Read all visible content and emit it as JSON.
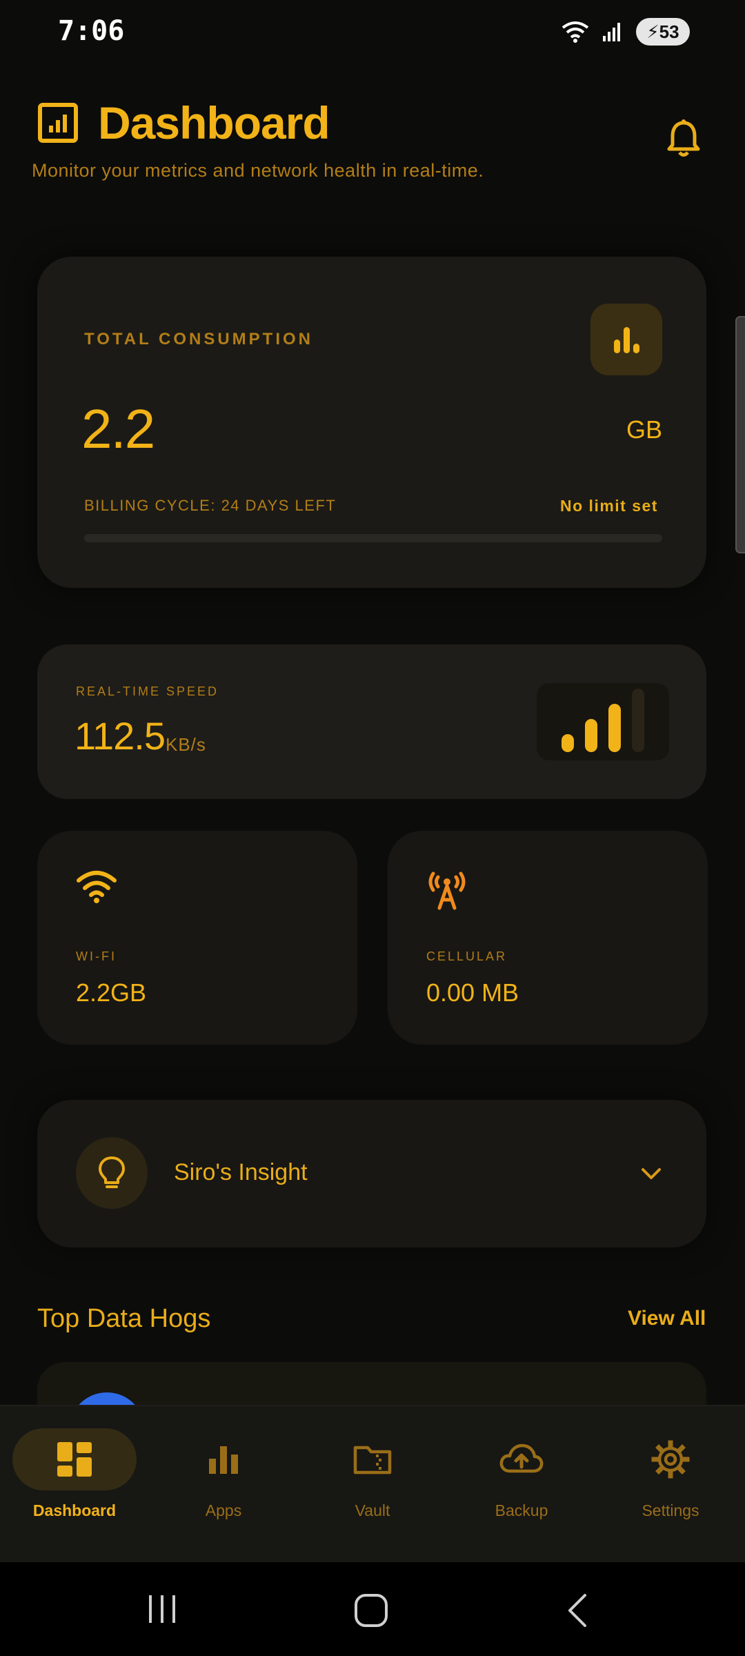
{
  "status_bar": {
    "time": "7:06",
    "battery": "53"
  },
  "header": {
    "title": "Dashboard",
    "subtitle": "Monitor your metrics and network health in real-time."
  },
  "total_consumption": {
    "label": "TOTAL CONSUMPTION",
    "value": "2.2",
    "unit": "GB",
    "billing": "BILLING CYCLE: 24 DAYS LEFT",
    "limit": "No limit set",
    "progress": 0
  },
  "realtime_speed": {
    "label": "REAL-TIME SPEED",
    "value": "112.5",
    "unit": "KB/s",
    "signal_bars_active": 3,
    "signal_bars_total": 4
  },
  "wifi": {
    "label": "WI-FI",
    "value": "2.2GB"
  },
  "cellular": {
    "label": "CELLULAR",
    "value": "0.00 MB"
  },
  "insight": {
    "title": "Siro's Insight"
  },
  "top_data_hogs": {
    "title": "Top Data Hogs",
    "view_all": "View All"
  },
  "bottom_nav": {
    "items": [
      {
        "label": "Dashboard",
        "icon": "dashboard-icon",
        "active": true
      },
      {
        "label": "Apps",
        "icon": "bar-chart-icon",
        "active": false
      },
      {
        "label": "Vault",
        "icon": "folder-icon",
        "active": false
      },
      {
        "label": "Backup",
        "icon": "cloud-upload-icon",
        "active": false
      },
      {
        "label": "Settings",
        "icon": "gear-icon",
        "active": false
      }
    ]
  },
  "colors": {
    "accent": "#f2b318",
    "muted": "#b37e17",
    "background": "#0c0c0b",
    "card": "#1b1a16",
    "cellular_icon": "#f08a1c"
  }
}
